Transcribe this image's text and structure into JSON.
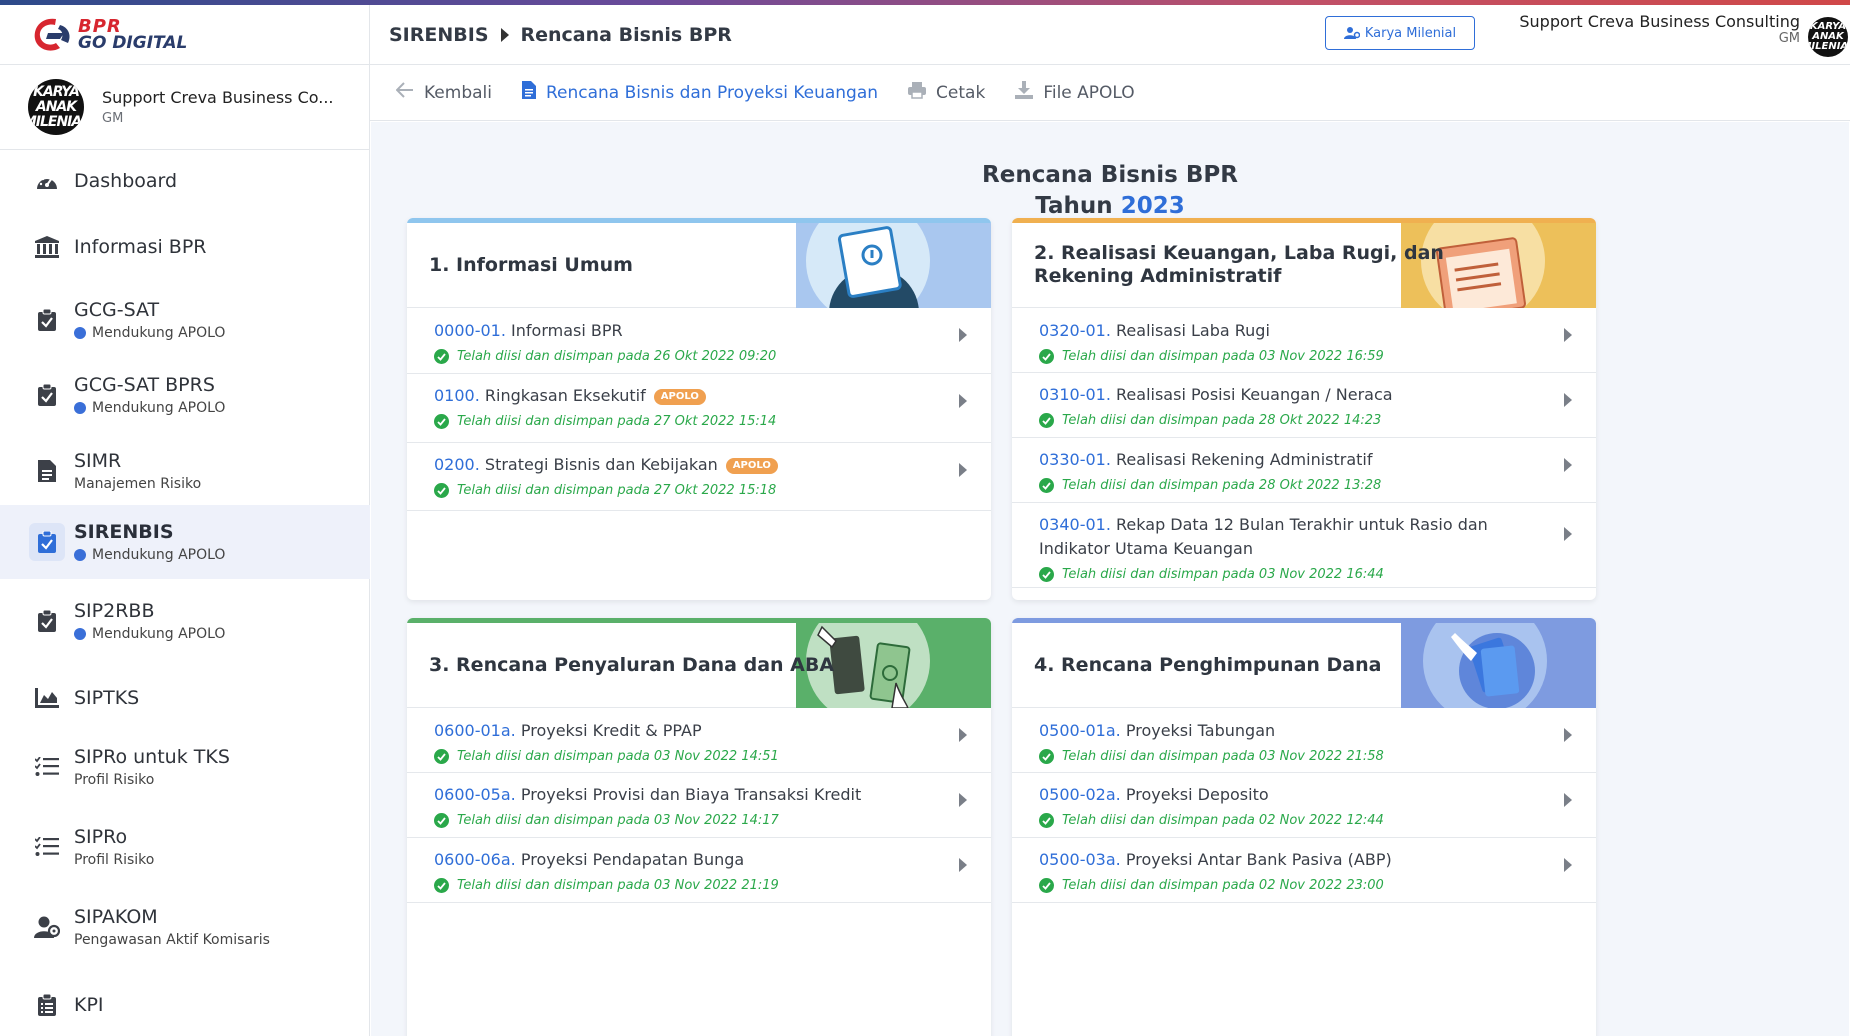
{
  "brand": {
    "line1": "BPR",
    "line2": "GO DIGITAL"
  },
  "profile": {
    "avatar_text": "KARYA ANAK MILENIAL",
    "name": "Support Creva Business Co...",
    "role": "GM"
  },
  "nav": [
    {
      "label": "Dashboard",
      "icon": "gauge-icon"
    },
    {
      "label": "Informasi BPR",
      "icon": "bank-icon"
    },
    {
      "label": "GCG-SAT",
      "sub": "Mendukung APOLO",
      "icon": "clipboard-check-icon"
    },
    {
      "label": "GCG-SAT BPRS",
      "sub": "Mendukung APOLO",
      "icon": "clipboard-check-icon"
    },
    {
      "label": "SIMR",
      "sub": "Manajemen Risiko",
      "icon": "document-icon"
    },
    {
      "label": "SIRENBIS",
      "sub": "Mendukung APOLO",
      "icon": "clipboard-check-icon"
    },
    {
      "label": "SIP2RBB",
      "sub": "Mendukung APOLO",
      "icon": "clipboard-check-icon"
    },
    {
      "label": "SIPTKS",
      "icon": "area-chart-icon"
    },
    {
      "label": "SIPRo untuk TKS",
      "sub": "Profil Risiko",
      "icon": "checklist-icon"
    },
    {
      "label": "SIPRo",
      "sub": "Profil Risiko",
      "icon": "checklist-icon"
    },
    {
      "label": "SIPAKOM",
      "sub": "Pengawasan Aktif Komisaris",
      "icon": "user-gear-icon"
    },
    {
      "label": "KPI",
      "icon": "clipboard-list-icon"
    }
  ],
  "header": {
    "crumb1": "SIRENBIS",
    "crumb2": "Rencana Bisnis BPR",
    "karya_button": "Karya Milenial",
    "user_name": "Support Creva Business Consulting",
    "user_role": "GM",
    "avatar_text": "KARYA ANAK MILENIAL"
  },
  "toolbar": {
    "back": "Kembali",
    "rbpk": "Rencana Bisnis dan Proyeksi Keuangan",
    "print": "Cetak",
    "apolo": "File APOLO"
  },
  "main": {
    "title": "Rencana Bisnis BPR",
    "year_prefix": "Tahun",
    "year": "2023"
  },
  "colors": {
    "accent": "#2f6ed8",
    "success": "#2aa84a",
    "badge": "#f0a050"
  },
  "cards": [
    {
      "title": "1. Informasi Umum",
      "rows": [
        {
          "code": "0000-01.",
          "text": "Informasi BPR",
          "status": "Telah diisi dan disimpan pada 26 Okt 2022 09:20"
        },
        {
          "code": "0100.",
          "text": "Ringkasan Eksekutif",
          "badge": "APOLO",
          "status": "Telah diisi dan disimpan pada 27 Okt 2022 15:14"
        },
        {
          "code": "0200.",
          "text": "Strategi Bisnis dan Kebijakan",
          "badge": "APOLO",
          "status": "Telah diisi dan disimpan pada 27 Okt 2022 15:18"
        }
      ]
    },
    {
      "title": "2. Realisasi Keuangan, Laba Rugi, dan Rekening Administratif",
      "rows": [
        {
          "code": "0320-01.",
          "text": "Realisasi Laba Rugi",
          "status": "Telah diisi dan disimpan pada 03 Nov 2022 16:59"
        },
        {
          "code": "0310-01.",
          "text": "Realisasi Posisi Keuangan / Neraca",
          "status": "Telah diisi dan disimpan pada 28 Okt 2022 14:23"
        },
        {
          "code": "0330-01.",
          "text": "Realisasi Rekening Administratif",
          "status": "Telah diisi dan disimpan pada 28 Okt 2022 13:28"
        },
        {
          "code": "0340-01.",
          "text": "Rekap Data 12 Bulan Terakhir untuk Rasio dan Indikator Utama Keuangan",
          "status": "Telah diisi dan disimpan pada 03 Nov 2022 16:44"
        }
      ]
    },
    {
      "title": "3. Rencana Penyaluran Dana dan ABA",
      "rows": [
        {
          "code": "0600-01a.",
          "text": "Proyeksi Kredit & PPAP",
          "status": "Telah diisi dan disimpan pada 03 Nov 2022 14:51"
        },
        {
          "code": "0600-05a.",
          "text": "Proyeksi Provisi dan Biaya Transaksi Kredit",
          "status": "Telah diisi dan disimpan pada 03 Nov 2022 14:17"
        },
        {
          "code": "0600-06a.",
          "text": "Proyeksi Pendapatan Bunga",
          "status": "Telah diisi dan disimpan pada 03 Nov 2022 21:19"
        }
      ]
    },
    {
      "title": "4. Rencana Penghimpunan Dana",
      "rows": [
        {
          "code": "0500-01a.",
          "text": "Proyeksi Tabungan",
          "status": "Telah diisi dan disimpan pada 03 Nov 2022 21:58"
        },
        {
          "code": "0500-02a.",
          "text": "Proyeksi Deposito",
          "status": "Telah diisi dan disimpan pada 02 Nov 2022 12:44"
        },
        {
          "code": "0500-03a.",
          "text": "Proyeksi Antar Bank Pasiva (ABP)",
          "status": "Telah diisi dan disimpan pada 02 Nov 2022 23:00"
        }
      ]
    }
  ]
}
